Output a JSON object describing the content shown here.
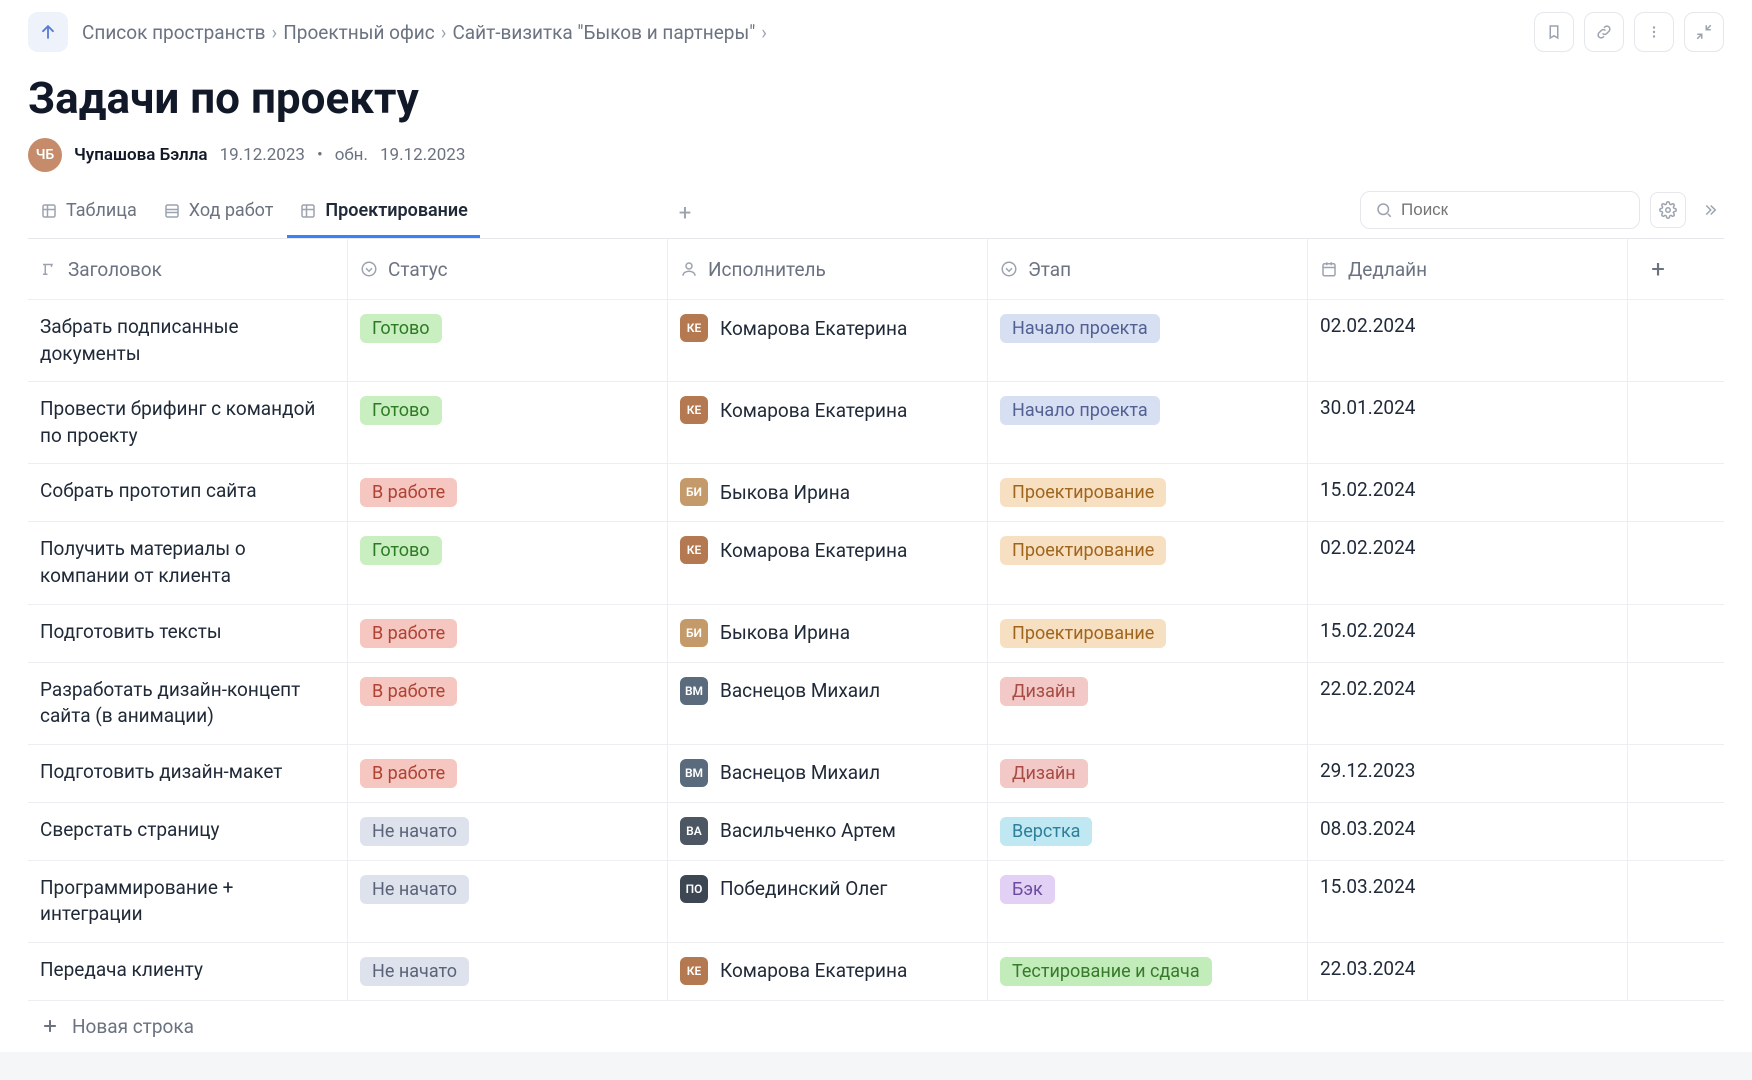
{
  "breadcrumbs": [
    "Список пространств",
    "Проектный офис",
    "Сайт-визитка \"Быков и партнеры\""
  ],
  "page_title": "Задачи по проекту",
  "author": {
    "name": "Чупашова Бэлла",
    "initials": "ЧБ"
  },
  "dates": {
    "created": "19.12.2023",
    "updated_prefix": "обн.",
    "updated": "19.12.2023"
  },
  "tabs": [
    {
      "label": "Таблица",
      "active": false
    },
    {
      "label": "Ход работ",
      "active": false
    },
    {
      "label": "Проектирование",
      "active": true
    }
  ],
  "search": {
    "placeholder": "Поиск"
  },
  "columns": {
    "title": "Заголовок",
    "status": "Статус",
    "assignee": "Исполнитель",
    "stage": "Этап",
    "deadline": "Дедлайн"
  },
  "status_labels": {
    "done": "Готово",
    "progress": "В работе",
    "notstarted": "Не начато"
  },
  "stage_labels": {
    "start": "Начало проекта",
    "design": "Проектирование",
    "ui": "Дизайн",
    "html": "Верстка",
    "back": "Бэк",
    "test": "Тестирование и сдача"
  },
  "people": {
    "komarova": {
      "name": "Комарова Екатерина",
      "initials": "КЕ",
      "color": "#b47950"
    },
    "bykova": {
      "name": "Быкова Ирина",
      "initials": "БИ",
      "color": "#c59a6b"
    },
    "vasnetsov": {
      "name": "Васнецов Михаил",
      "initials": "ВМ",
      "color": "#5a6b7d"
    },
    "vasilchenko": {
      "name": "Васильченко Артем",
      "initials": "ВА",
      "color": "#4d5663"
    },
    "pobedinsky": {
      "name": "Побединский Олег",
      "initials": "ПО",
      "color": "#3d4753"
    }
  },
  "rows": [
    {
      "title": "Забрать подписанные документы",
      "status": "done",
      "assignee": "komarova",
      "stage": "start",
      "deadline": "02.02.2024"
    },
    {
      "title": "Провести брифинг с командой по проекту",
      "status": "done",
      "assignee": "komarova",
      "stage": "start",
      "deadline": "30.01.2024"
    },
    {
      "title": "Собрать прототип сайта",
      "status": "progress",
      "assignee": "bykova",
      "stage": "design",
      "deadline": "15.02.2024"
    },
    {
      "title": "Получить материалы о компании от клиента",
      "status": "done",
      "assignee": "komarova",
      "stage": "design",
      "deadline": "02.02.2024"
    },
    {
      "title": "Подготовить тексты",
      "status": "progress",
      "assignee": "bykova",
      "stage": "design",
      "deadline": "15.02.2024"
    },
    {
      "title": "Разработать дизайн-концепт сайта (в анимации)",
      "status": "progress",
      "assignee": "vasnetsov",
      "stage": "ui",
      "deadline": "22.02.2024"
    },
    {
      "title": "Подготовить дизайн-макет",
      "status": "progress",
      "assignee": "vasnetsov",
      "stage": "ui",
      "deadline": "29.12.2023"
    },
    {
      "title": "Сверстать страницу",
      "status": "notstarted",
      "assignee": "vasilchenko",
      "stage": "html",
      "deadline": "08.03.2024"
    },
    {
      "title": "Программирование + интеграции",
      "status": "notstarted",
      "assignee": "pobedinsky",
      "stage": "back",
      "deadline": "15.03.2024"
    },
    {
      "title": "Передача клиенту",
      "status": "notstarted",
      "assignee": "komarova",
      "stage": "test",
      "deadline": "22.03.2024"
    }
  ],
  "new_row_label": "Новая строка"
}
